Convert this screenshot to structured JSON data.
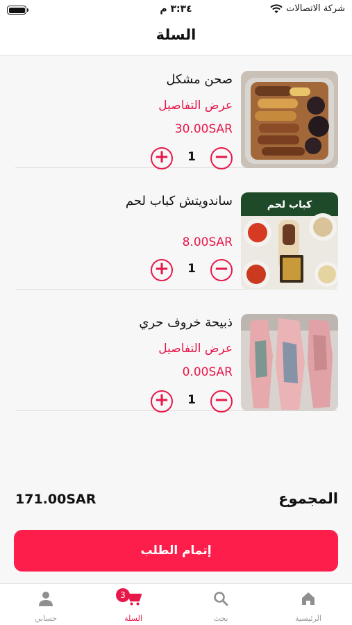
{
  "status_bar": {
    "carrier": "شركة الاتصالات",
    "time": "٣:٣٤ م"
  },
  "header": {
    "title": "السلة"
  },
  "cart": {
    "items": [
      {
        "name": "صحن مشكل",
        "details_label": "عرض التفاصيل",
        "price": "30.00SAR",
        "quantity": "1",
        "image_icon": "mixed-grill-plate"
      },
      {
        "name": "ساندويتش كباب لحم",
        "price": "8.00SAR",
        "quantity": "1",
        "image_icon": "kebab-sandwich"
      },
      {
        "name": "ذبيحة خروف حري",
        "details_label": "عرض التفاصيل",
        "price": "0.00SAR",
        "quantity": "1",
        "image_icon": "lamb-carcass"
      }
    ],
    "plus_symbol": "+",
    "minus_symbol": "−"
  },
  "total": {
    "label": "المجموع",
    "value": "171.00SAR"
  },
  "checkout": {
    "label": "إتمام الطلب"
  },
  "tab_bar": {
    "tabs": [
      {
        "label": "الرئيسية",
        "icon": "home-icon"
      },
      {
        "label": "بحث",
        "icon": "search-icon"
      },
      {
        "label": "السلة",
        "icon": "cart-icon",
        "badge": "3",
        "active": true
      },
      {
        "label": "حسابي",
        "icon": "person-icon"
      }
    ]
  },
  "colors": {
    "accent": "#e8174a",
    "button": "#fe1e4b",
    "inactive_tab": "#9a9a9a"
  }
}
